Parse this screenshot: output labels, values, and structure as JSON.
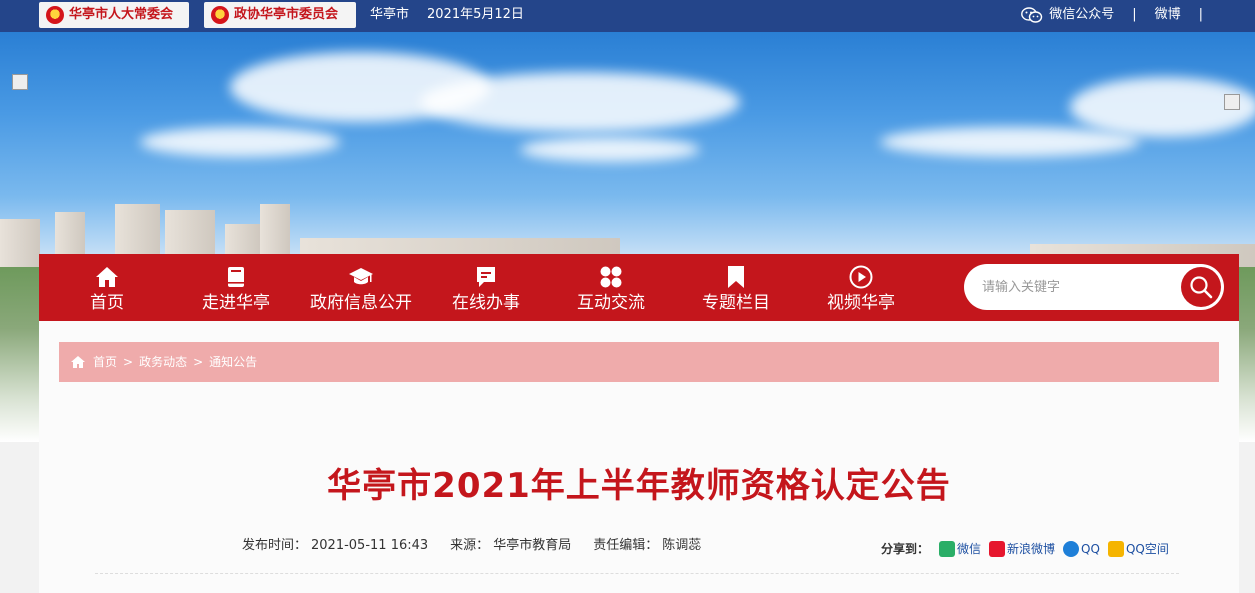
{
  "topbar": {
    "btn_npc": "华亭市人大常委会",
    "btn_cppcc": "政协华亭市委员会",
    "city": "华亭市",
    "date": "2021年5月12日",
    "wechat": "微信公众号",
    "sep1": "|",
    "weibo": "微博",
    "sep2": "|"
  },
  "nav": {
    "items": [
      {
        "label": "首页",
        "icon": "home-icon"
      },
      {
        "label": "走进华亭",
        "icon": "book-icon"
      },
      {
        "label": "政府信息公开",
        "icon": "graduation-cap-icon"
      },
      {
        "label": "在线办事",
        "icon": "chat-icon"
      },
      {
        "label": "互动交流",
        "icon": "grid-icon"
      },
      {
        "label": "专题栏目",
        "icon": "bookmark-icon"
      },
      {
        "label": "视频华亭",
        "icon": "play-icon"
      }
    ],
    "search_placeholder": "请输入关键字"
  },
  "breadcrumb": {
    "home": "首页",
    "sep": ">",
    "level1": "政务动态",
    "level2": "通知公告"
  },
  "article": {
    "title": "华亭市2021年上半年教师资格认定公告",
    "publish_label": "发布时间：",
    "publish_time": "2021-05-11 16:43",
    "source_label": "来源：",
    "source": "华亭市教育局",
    "editor_label": "责任编辑：",
    "editor": "陈调蕊"
  },
  "share": {
    "label": "分享到：",
    "items": [
      {
        "label": "微信",
        "color": "#2aae67"
      },
      {
        "label": "新浪微博",
        "color": "#e6162d"
      },
      {
        "label": "QQ",
        "color": "#1e7fd8"
      },
      {
        "label": "QQ空间",
        "color": "#f5b400"
      }
    ]
  },
  "colors": {
    "brand_red": "#c4161c",
    "topbar_blue": "#24458a",
    "breadcrumb_pink": "#efabab",
    "link_blue": "#1e50a2"
  }
}
